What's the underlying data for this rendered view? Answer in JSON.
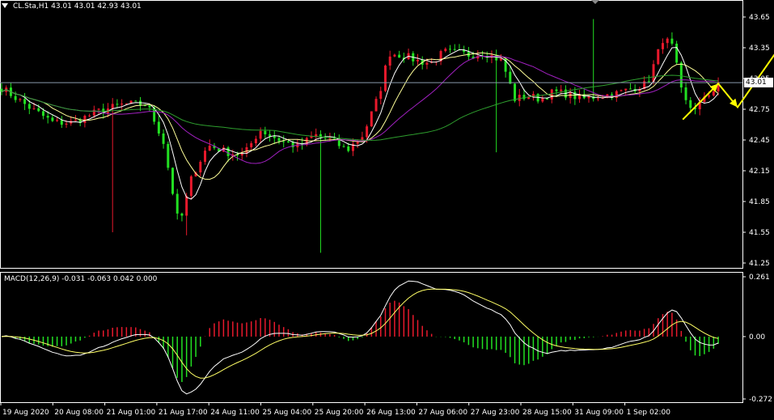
{
  "header": {
    "symbol_info": "CL.Sta,H1  43.01 43.01 42.93 43.01",
    "macd_info": "MACD(12,26,9) -0.031 -0.063 0.042 0.000"
  },
  "current_price": "43.01",
  "colors": {
    "background": "#000000",
    "up_candle": "#e8192c",
    "down_candle": "#22e022",
    "ma_fast": "#ffffff",
    "ma_mid": "#ffff99",
    "ma_slow": "#a020c0",
    "ma_long": "#2e9e2e",
    "macd_line": "#ffffff",
    "signal_line": "#ffff66",
    "arrow": "#ffff00",
    "price_line": "#8899aa",
    "axis": "#ffffff"
  },
  "chart_data": [
    {
      "type": "candlestick",
      "title": "CL.Sta,H1",
      "ylim": [
        41.25,
        43.65
      ],
      "yticks": [
        "43.65",
        "43.35",
        "43.05",
        "42.75",
        "42.45",
        "42.15",
        "41.85",
        "41.55",
        "41.25"
      ],
      "ytick_values": [
        43.65,
        43.35,
        43.05,
        42.75,
        42.45,
        42.15,
        41.85,
        41.55,
        41.25
      ],
      "xticks": [
        "19 Aug 2020",
        "20 Aug 08:00",
        "21 Aug 01:00",
        "21 Aug 17:00",
        "24 Aug 11:00",
        "25 Aug 04:00",
        "25 Aug 20:00",
        "26 Aug 13:00",
        "27 Aug 06:00",
        "27 Aug 23:00",
        "28 Aug 15:00",
        "31 Aug 09:00",
        "1 Sep 02:00"
      ],
      "bars": 156,
      "close_path": [
        [
          0,
          42.96
        ],
        [
          8,
          42.78
        ],
        [
          16,
          42.62
        ],
        [
          22,
          42.62
        ],
        [
          30,
          42.73
        ],
        [
          38,
          42.8
        ],
        [
          45,
          42.8
        ],
        [
          50,
          42.45
        ],
        [
          55,
          41.6
        ],
        [
          59,
          42.1
        ],
        [
          64,
          42.4
        ],
        [
          70,
          42.33
        ],
        [
          75,
          42.3
        ],
        [
          80,
          42.55
        ],
        [
          86,
          42.45
        ],
        [
          92,
          42.38
        ],
        [
          97,
          42.5
        ],
        [
          102,
          42.45
        ],
        [
          107,
          42.35
        ],
        [
          112,
          42.5
        ],
        [
          117,
          42.9
        ],
        [
          120,
          43.3
        ],
        [
          125,
          43.27
        ],
        [
          129,
          43.22
        ],
        [
          133,
          43.2
        ],
        [
          137,
          43.31
        ],
        [
          141,
          43.3
        ],
        [
          145,
          43.28
        ],
        [
          150,
          43.3
        ],
        [
          155,
          43.22
        ],
        [
          159,
          42.85
        ],
        [
          163,
          42.88
        ],
        [
          167,
          42.85
        ],
        [
          171,
          42.92
        ],
        [
          175,
          42.9
        ],
        [
          180,
          42.85
        ],
        [
          185,
          42.88
        ],
        [
          190,
          42.9
        ],
        [
          195,
          42.95
        ],
        [
          200,
          43.0
        ],
        [
          205,
          43.45
        ],
        [
          208,
          43.35
        ],
        [
          211,
          42.85
        ],
        [
          214,
          42.75
        ],
        [
          217,
          42.82
        ],
        [
          220,
          42.92
        ],
        [
          222,
          43.01
        ]
      ],
      "moving_averages": [
        {
          "name": "",
          "color_key": "ma_fast",
          "period": 5
        },
        {
          "name": "",
          "color_key": "ma_mid",
          "period": 10
        },
        {
          "name": "",
          "color_key": "ma_slow",
          "period": 21
        },
        {
          "name": "",
          "color_key": "ma_long",
          "period": 60
        }
      ],
      "annotations": [
        {
          "type": "arrow_path",
          "color_key": "arrow",
          "points": [
            [
              211,
              42.65
            ],
            [
              222,
              43.0
            ],
            [
              228,
              42.77
            ],
            [
              246,
              43.58
            ]
          ]
        }
      ]
    },
    {
      "type": "histogram+line",
      "title": "MACD(12,26,9)",
      "ylim": [
        -0.272,
        0.261
      ],
      "yticks": [
        "0.261",
        "0.00",
        "-0.272"
      ],
      "ytick_values": [
        0.261,
        0.0,
        -0.272
      ],
      "macd": -0.031,
      "signal": -0.063,
      "histogram": 0.042
    }
  ]
}
